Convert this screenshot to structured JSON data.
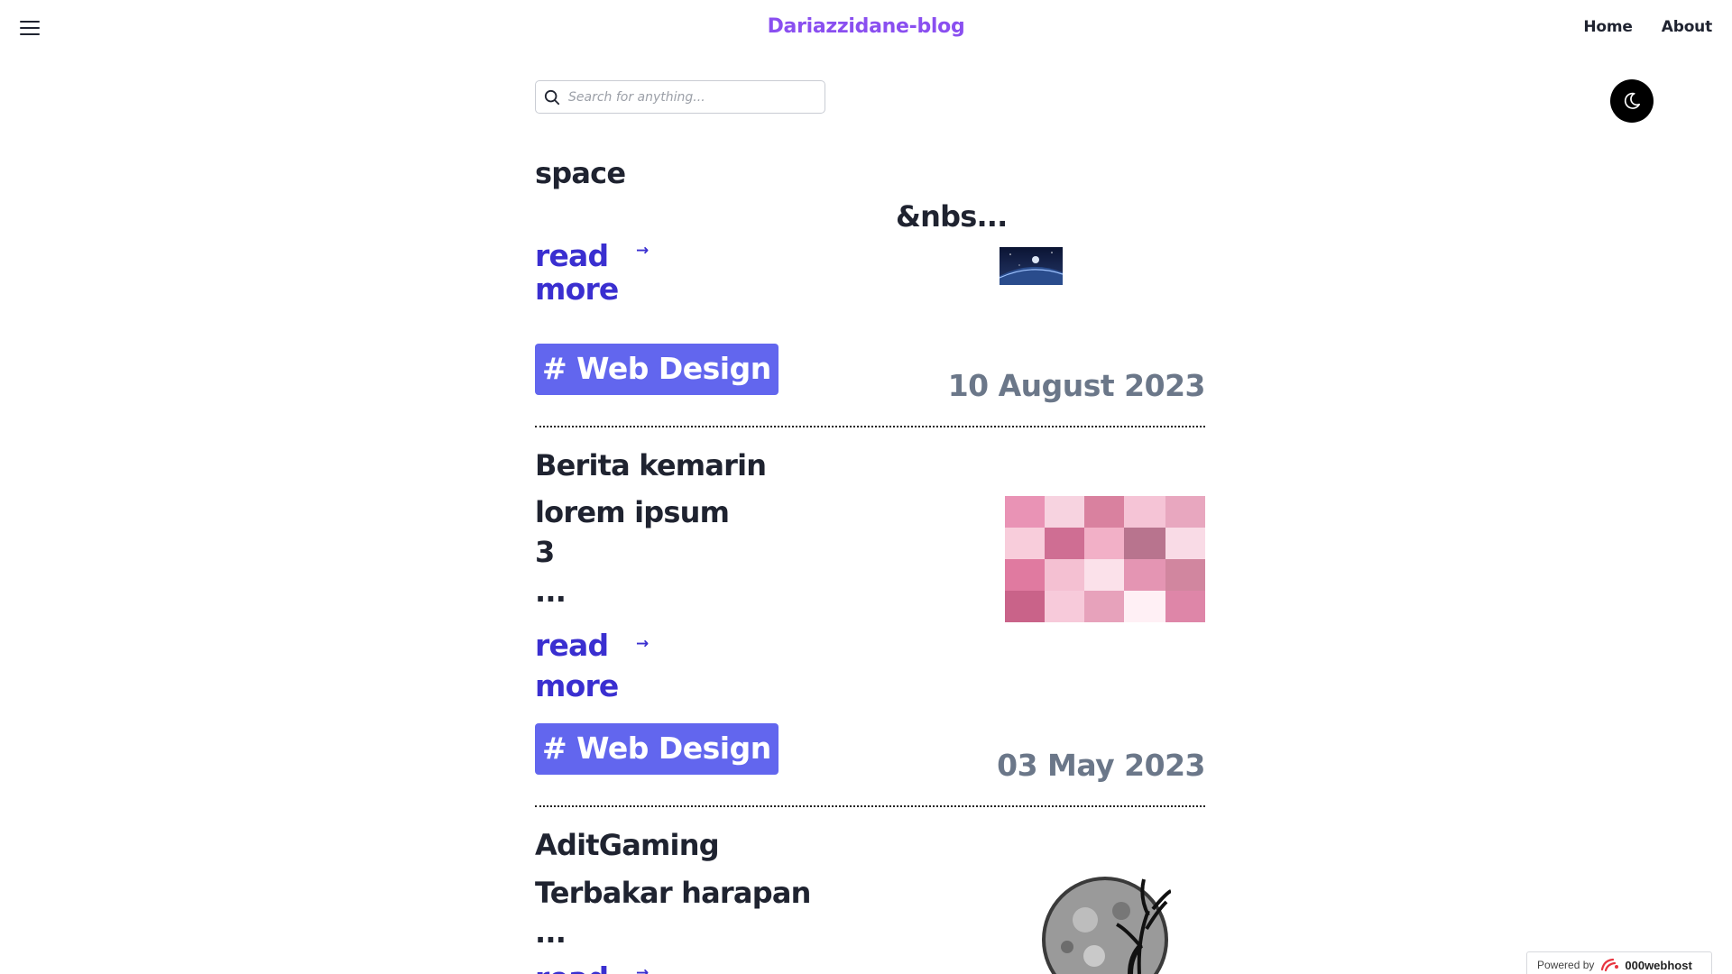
{
  "header": {
    "site_title": "Dariazzidane-blog",
    "nav": [
      "Home",
      "About"
    ]
  },
  "search": {
    "placeholder": "Search for anything..."
  },
  "posts": [
    {
      "title": "space",
      "excerpt": "&nbs...",
      "read_more": [
        "read",
        "more"
      ],
      "tag": "# Web Design",
      "date": "10 August 2023"
    },
    {
      "title": "Berita kemarin",
      "excerpt_lines": [
        "lorem ipsum",
        "3",
        "..."
      ],
      "read_more": [
        "read",
        "more"
      ],
      "tag": "# Web Design",
      "date": "03 May 2023"
    },
    {
      "title": "AditGaming",
      "excerpt_lines": [
        "Terbakar harapan",
        "..."
      ],
      "read_more": [
        "read"
      ]
    }
  ],
  "footer": {
    "powered_by": "Powered by",
    "brand": "000webhost"
  },
  "colors": {
    "accent": "#8a4ff0",
    "link": "#3a2fd0",
    "tag_bg": "#6266ee",
    "date": "#6b7789"
  }
}
